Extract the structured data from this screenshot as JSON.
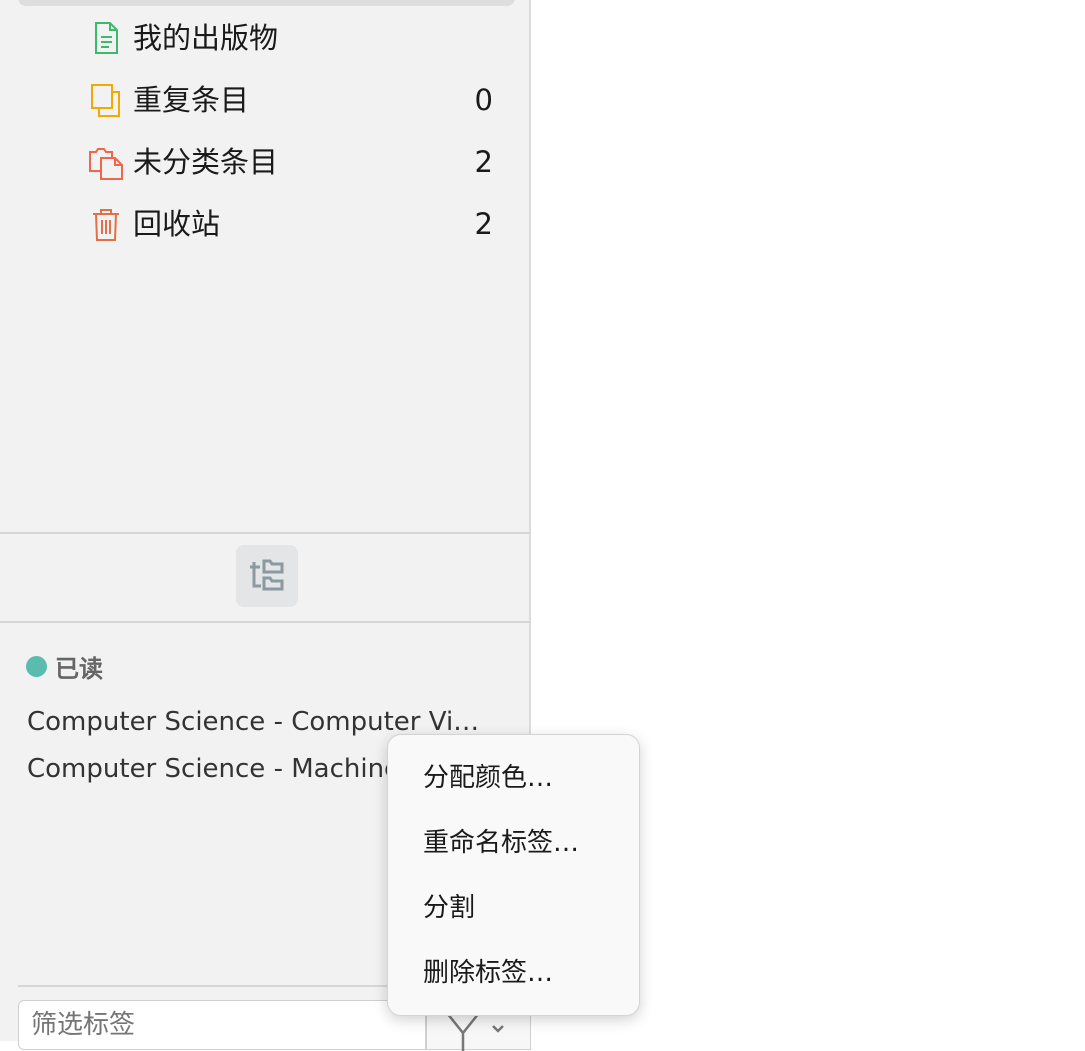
{
  "collections": [
    {
      "label": "我的出版物",
      "count": "",
      "icon": "publications-icon",
      "color": "#3cb96a"
    },
    {
      "label": "重复条目",
      "count": "0",
      "icon": "duplicates-icon",
      "color": "#f2a900"
    },
    {
      "label": "未分类条目",
      "count": "2",
      "icon": "unfiled-icon",
      "color": "#f0664a"
    },
    {
      "label": "回收站",
      "count": "2",
      "icon": "trash-icon",
      "color": "#e0704a"
    }
  ],
  "tag_selector": {
    "colored_tag": {
      "label": "已读",
      "color": "#5bbcad"
    },
    "tags": [
      "Computer Science - Computer Vision and Pattern Recognition",
      "Computer Science - Machine Learning"
    ],
    "filter_placeholder": "筛选标签"
  },
  "context_menu": {
    "items": [
      "分配颜色…",
      "重命名标签…",
      "分割",
      "删除标签…"
    ]
  }
}
